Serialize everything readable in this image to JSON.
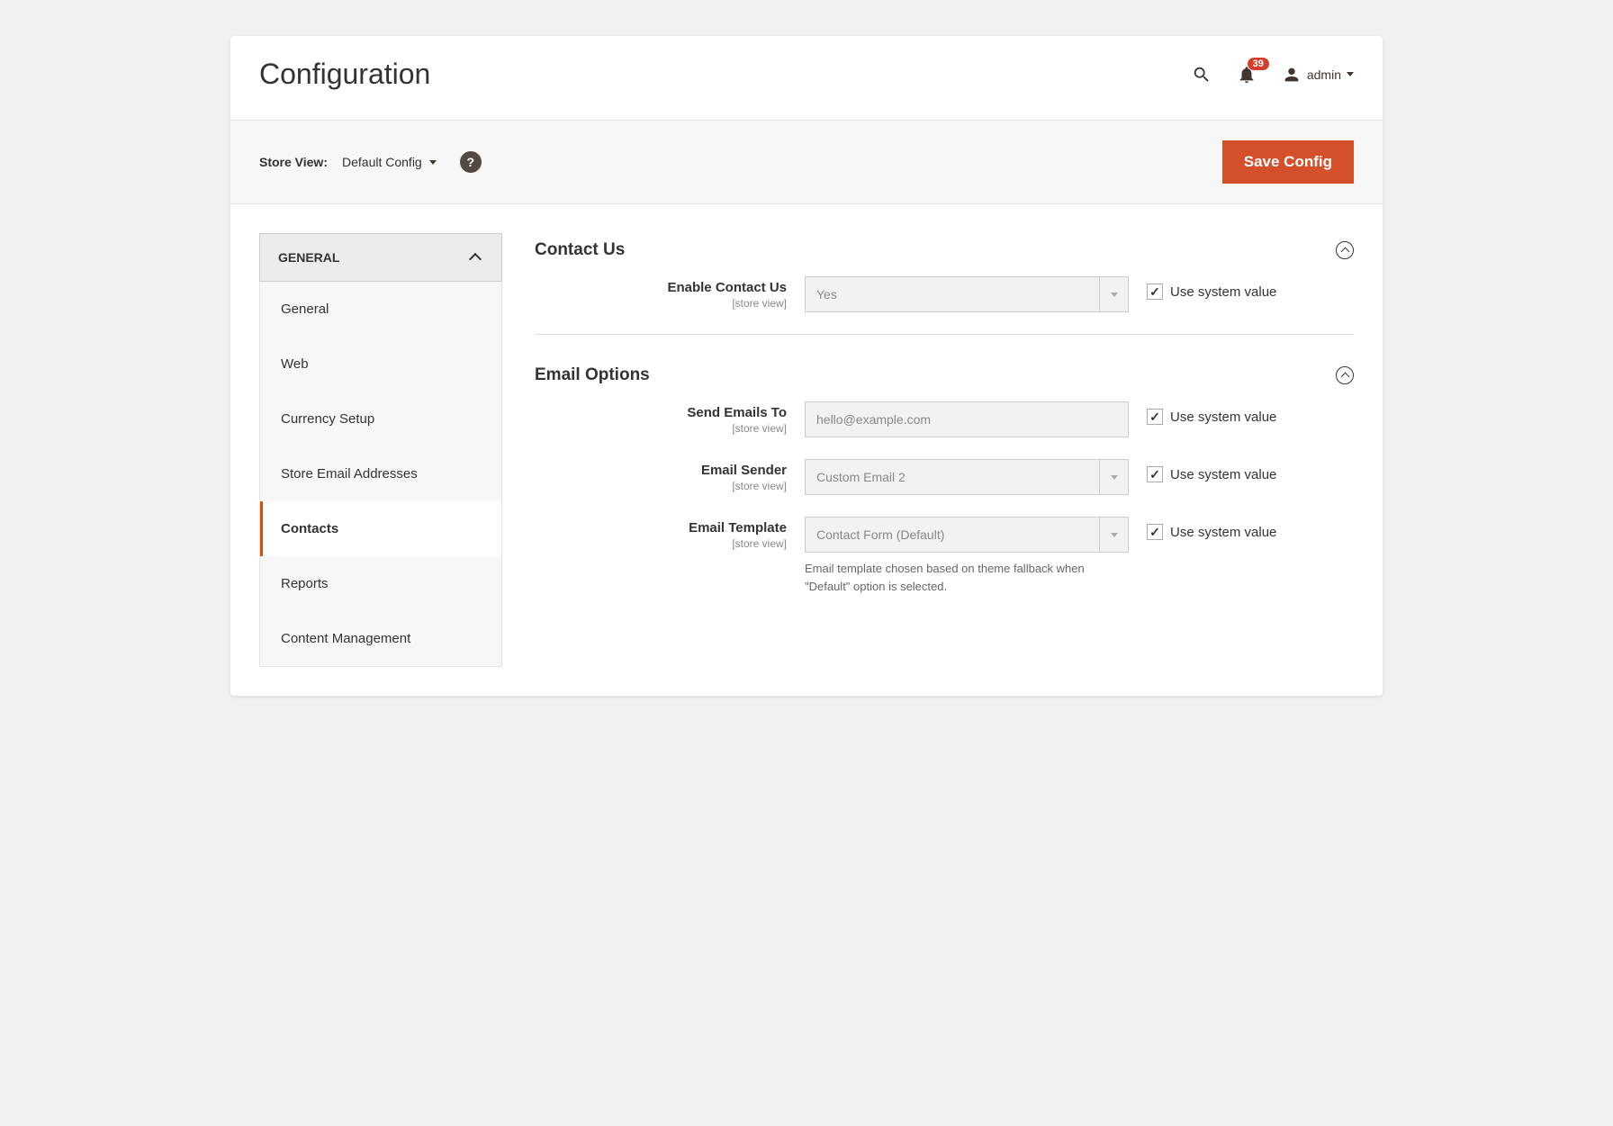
{
  "page": {
    "title": "Configuration"
  },
  "header": {
    "notification_count": "39",
    "user_label": "admin"
  },
  "toolbar": {
    "store_view_label": "Store View:",
    "store_view_value": "Default Config",
    "save_button": "Save Config"
  },
  "sidebar": {
    "group_title": "GENERAL",
    "items": [
      {
        "label": "General",
        "active": false
      },
      {
        "label": "Web",
        "active": false
      },
      {
        "label": "Currency Setup",
        "active": false
      },
      {
        "label": "Store Email Addresses",
        "active": false
      },
      {
        "label": "Contacts",
        "active": true
      },
      {
        "label": "Reports",
        "active": false
      },
      {
        "label": "Content Management",
        "active": false
      }
    ]
  },
  "sections": {
    "contact_us": {
      "title": "Contact Us",
      "fields": {
        "enable": {
          "label": "Enable Contact Us",
          "scope": "[store view]",
          "value": "Yes",
          "use_system": "Use system value"
        }
      }
    },
    "email_options": {
      "title": "Email Options",
      "fields": {
        "send_to": {
          "label": "Send Emails To",
          "scope": "[store view]",
          "value": "hello@example.com",
          "use_system": "Use system value"
        },
        "sender": {
          "label": "Email Sender",
          "scope": "[store view]",
          "value": "Custom Email 2",
          "use_system": "Use system value"
        },
        "template": {
          "label": "Email Template",
          "scope": "[store view]",
          "value": "Contact Form (Default)",
          "hint": "Email template chosen based on theme fallback when \"Default\" option is selected.",
          "use_system": "Use system value"
        }
      }
    }
  }
}
